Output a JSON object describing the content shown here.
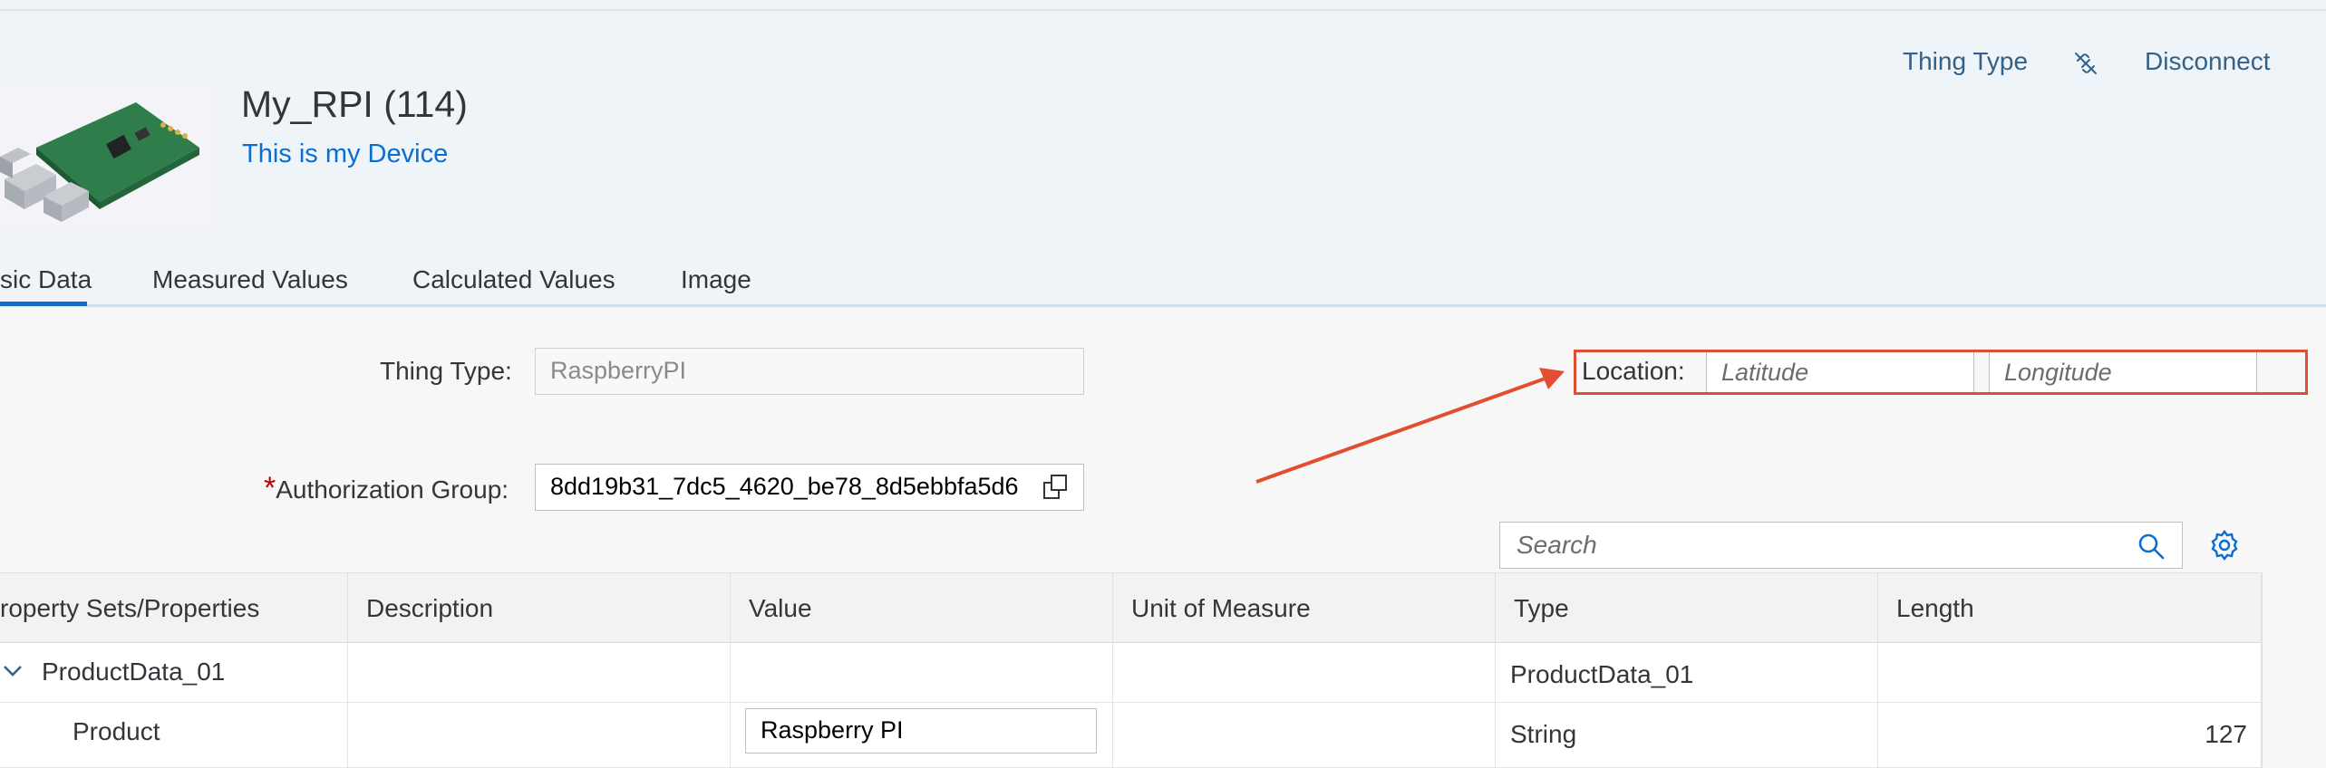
{
  "header": {
    "title": "My_RPI (114)",
    "subtitle": "This is my Device",
    "thing_type_link": "Thing Type",
    "disconnect_link": "Disconnect"
  },
  "tabs": [
    {
      "label": "sic Data",
      "selected": true
    },
    {
      "label": "Measured Values"
    },
    {
      "label": "Calculated Values"
    },
    {
      "label": "Image"
    }
  ],
  "form": {
    "thing_type_label": "Thing Type:",
    "thing_type_value": "RaspberryPI",
    "required_marker": "*",
    "auth_group_label": "Authorization Group:",
    "auth_group_value": "8dd19b31_7dc5_4620_be78_8d5ebbfa5d6",
    "location_label": "Location:",
    "latitude_placeholder": "Latitude",
    "longitude_placeholder": "Longitude"
  },
  "search": {
    "placeholder": "Search"
  },
  "table": {
    "columns": [
      "roperty Sets/Properties",
      "Description",
      "Value",
      "Unit of Measure",
      "Type",
      "Length"
    ],
    "rows": [
      {
        "name": "ProductData_01",
        "description": "",
        "value": "",
        "unit": "",
        "type": "ProductData_01",
        "length": ""
      },
      {
        "name": "Product",
        "description": "",
        "value": "Raspberry PI",
        "unit": "",
        "type": "String",
        "length": "127"
      }
    ]
  },
  "icons": {
    "disconnect": "unlink-icon",
    "copy": "copy-icon",
    "search": "search-icon",
    "settings": "gear-icon",
    "expand": "chevron-down-icon"
  },
  "colors": {
    "accent": "#0a6ed1",
    "link": "#346187",
    "annotation": "#e24e32",
    "required": "#bb0000",
    "header_bg": "#eff4f9"
  }
}
